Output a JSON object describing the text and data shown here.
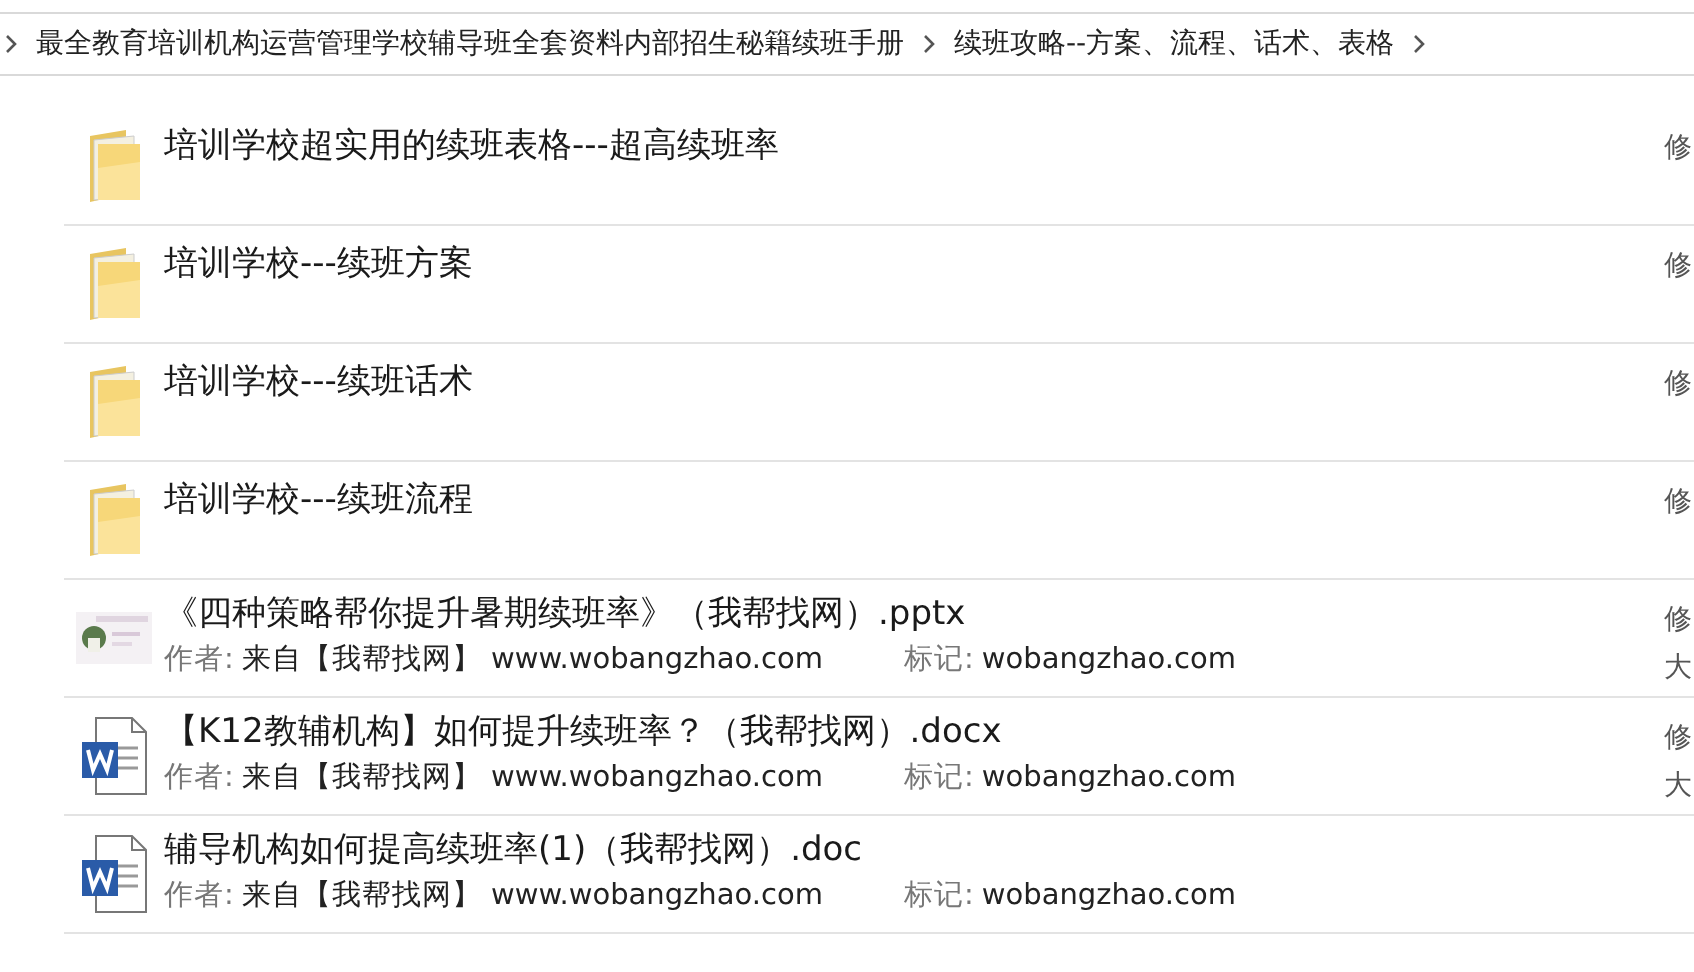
{
  "breadcrumb": [
    {
      "label": "最全教育培训机构运营管理学校辅导班全套资料内部招生秘籍续班手册"
    },
    {
      "label": "续班攻略--方案、流程、话术、表格"
    }
  ],
  "files": [
    {
      "kind": "folder",
      "name": "培训学校超实用的续班表格---超高续班率",
      "side": [
        "修"
      ]
    },
    {
      "kind": "folder",
      "name": "培训学校---续班方案",
      "side": [
        "修"
      ]
    },
    {
      "kind": "folder",
      "name": "培训学校---续班话术",
      "side": [
        "修"
      ]
    },
    {
      "kind": "folder",
      "name": "培训学校---续班流程",
      "side": [
        "修"
      ]
    },
    {
      "kind": "slides",
      "name": "《四种策略帮你提升暑期续班率》（我帮找网）.pptx",
      "author_label": "作者:",
      "author": "来自【我帮找网】 www.wobangzhao.com",
      "tag_label": "标记:",
      "tag": "wobangzhao.com",
      "side": [
        "修",
        "大"
      ]
    },
    {
      "kind": "word",
      "name": "【K12教辅机构】如何提升续班率？（我帮找网）.docx",
      "author_label": "作者:",
      "author": "来自【我帮找网】 www.wobangzhao.com",
      "tag_label": "标记:",
      "tag": "wobangzhao.com",
      "side": [
        "修",
        "大"
      ]
    },
    {
      "kind": "word",
      "name": "辅导机构如何提高续班率(1)（我帮找网）.doc",
      "author_label": "作者:",
      "author": "来自【我帮找网】 www.wobangzhao.com",
      "tag_label": "标记:",
      "tag": "wobangzhao.com"
    }
  ]
}
